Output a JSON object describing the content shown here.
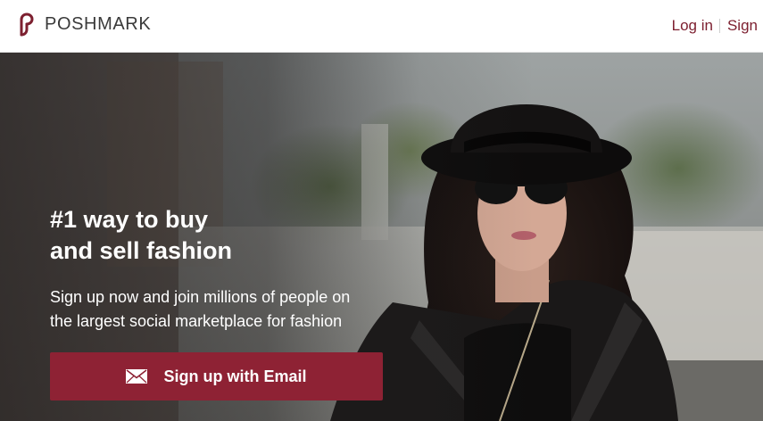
{
  "brand": {
    "name": "POSHMARK",
    "color": "#7d2030"
  },
  "header": {
    "login_label": "Log in",
    "signup_label": "Sign"
  },
  "hero": {
    "headline_line1": "#1 way to buy",
    "headline_line2": "and sell fashion",
    "subtext_line1": "Sign up now and join millions of people on",
    "subtext_line2": "the largest social marketplace for fashion",
    "cta_label": "Sign up with Email",
    "cta_icon": "envelope-icon",
    "cta_color": "#8e2234",
    "image": "woman in black hat and sunglasses"
  }
}
